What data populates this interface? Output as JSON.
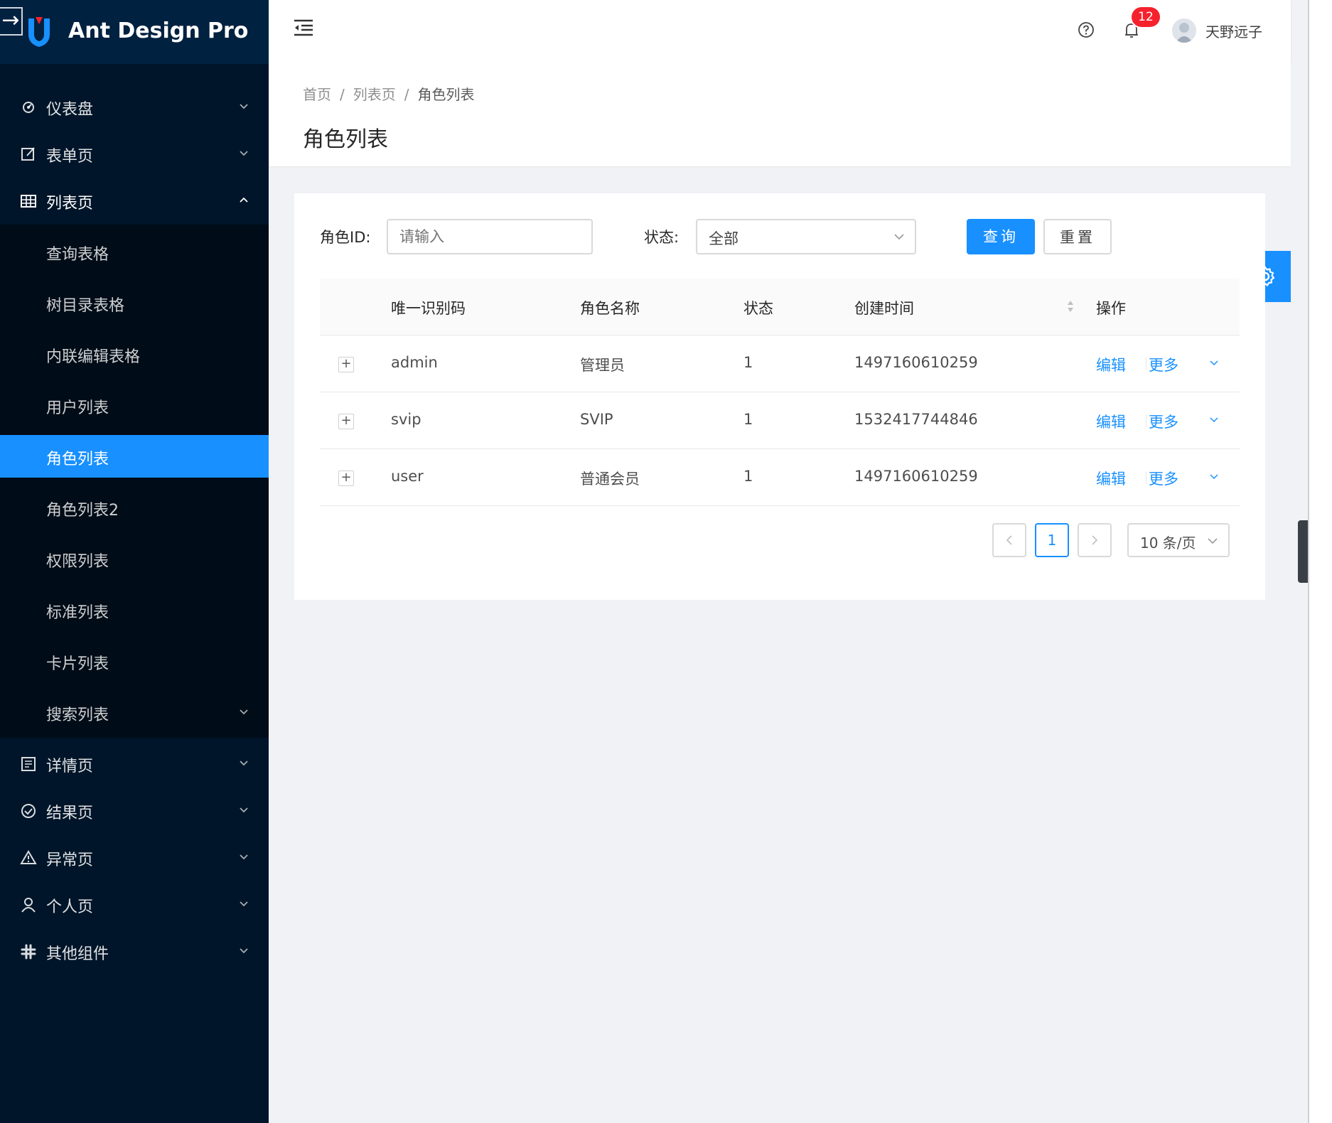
{
  "app": {
    "title": "Ant Design Pro",
    "accent_color": "#1890ff",
    "sider_color": "#001529"
  },
  "sidebar": {
    "back_icon": "arrow-right-icon",
    "items": [
      {
        "label": "仪表盘",
        "icon": "dashboard-icon",
        "expanded": false
      },
      {
        "label": "表单页",
        "icon": "form-icon",
        "expanded": false
      },
      {
        "label": "列表页",
        "icon": "table-icon",
        "expanded": true
      },
      {
        "label": "详情页",
        "icon": "profile-icon",
        "expanded": false
      },
      {
        "label": "结果页",
        "icon": "check-circle-icon",
        "expanded": false
      },
      {
        "label": "异常页",
        "icon": "warning-icon",
        "expanded": false
      },
      {
        "label": "个人页",
        "icon": "user-icon",
        "expanded": false
      },
      {
        "label": "其他组件",
        "icon": "slack-icon",
        "expanded": false
      }
    ],
    "list_submenu": [
      {
        "label": "查询表格"
      },
      {
        "label": "树目录表格"
      },
      {
        "label": "内联编辑表格"
      },
      {
        "label": "用户列表"
      },
      {
        "label": "角色列表",
        "active": true
      },
      {
        "label": "角色列表2"
      },
      {
        "label": "权限列表"
      },
      {
        "label": "标准列表"
      },
      {
        "label": "卡片列表"
      },
      {
        "label": "搜索列表",
        "has_children": true
      }
    ]
  },
  "header": {
    "notification_count": "12",
    "username": "天野远子"
  },
  "page": {
    "breadcrumb": [
      "首页",
      "列表页",
      "角色列表"
    ],
    "title": "角色列表"
  },
  "search_form": {
    "role_id_label": "角色ID:",
    "role_id_placeholder": "请输入",
    "status_label": "状态:",
    "status_value": "全部",
    "query_button": "查询",
    "reset_button": "重置"
  },
  "table": {
    "columns": [
      "唯一识别码",
      "角色名称",
      "状态",
      "创建时间",
      "操作"
    ],
    "rows": [
      {
        "id": "admin",
        "name": "管理员",
        "status": "1",
        "created": "1497160610259",
        "edit": "编辑",
        "more": "更多"
      },
      {
        "id": "svip",
        "name": "SVIP",
        "status": "1",
        "created": "1532417744846",
        "edit": "编辑",
        "more": "更多"
      },
      {
        "id": "user",
        "name": "普通会员",
        "status": "1",
        "created": "1497160610259",
        "edit": "编辑",
        "more": "更多"
      }
    ]
  },
  "pagination": {
    "current_page": "1",
    "page_size": "10 条/页"
  }
}
